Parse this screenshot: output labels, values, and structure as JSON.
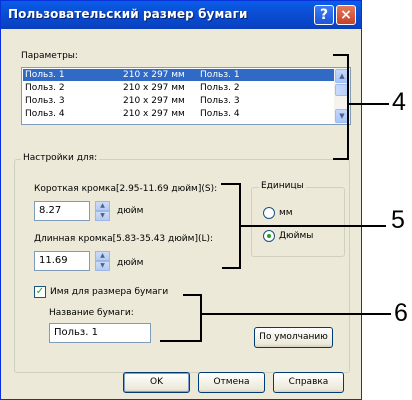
{
  "window": {
    "title": "Пользовательский размер бумаги",
    "help_glyph": "?",
    "close_glyph": "×"
  },
  "params": {
    "label": "Параметры:",
    "rows": [
      {
        "name": "Польз. 1",
        "size": "210 x 297 мм",
        "alias": "Польз. 1",
        "selected": true
      },
      {
        "name": "Польз. 2",
        "size": "210 x 297 мм",
        "alias": "Польз. 2"
      },
      {
        "name": "Польз. 3",
        "size": "210 x 297 мм",
        "alias": "Польз. 3"
      },
      {
        "name": "Польз. 4",
        "size": "210 x 297 мм",
        "alias": "Польз. 4"
      }
    ],
    "scroll_up": "▲",
    "scroll_down": "▼"
  },
  "settings": {
    "group_title": "Настройки для:",
    "short_edge_label": "Короткая кромка[2.95-11.69 дюйм](S):",
    "short_edge_value": "8.27",
    "long_edge_label": "Длинная кромка[5.83-35.43 дюйм](L):",
    "long_edge_value": "11.69",
    "unit_inch": "дюйм",
    "spin_up": "▲",
    "spin_down": "▼",
    "units": {
      "title": "Единицы",
      "mm_label": "мм",
      "inch_label": "Дюймы",
      "selected": "inch"
    }
  },
  "paper_name": {
    "checkbox_label": "Имя для размера бумаги",
    "checked": true,
    "check_glyph": "✓",
    "name_label": "Название бумаги:",
    "name_value": "Польз. 1",
    "default_button": "По умолчанию"
  },
  "buttons": {
    "ok": "OK",
    "cancel": "Отмена",
    "help": "Справка"
  },
  "annotations": {
    "callout_4": "4",
    "callout_5": "5",
    "callout_6": "6"
  },
  "colors": {
    "titlebar": "#0b4fd6",
    "selection": "#316ac5",
    "dialog_bg": "#ece9d8",
    "check_green": "#21a121"
  }
}
